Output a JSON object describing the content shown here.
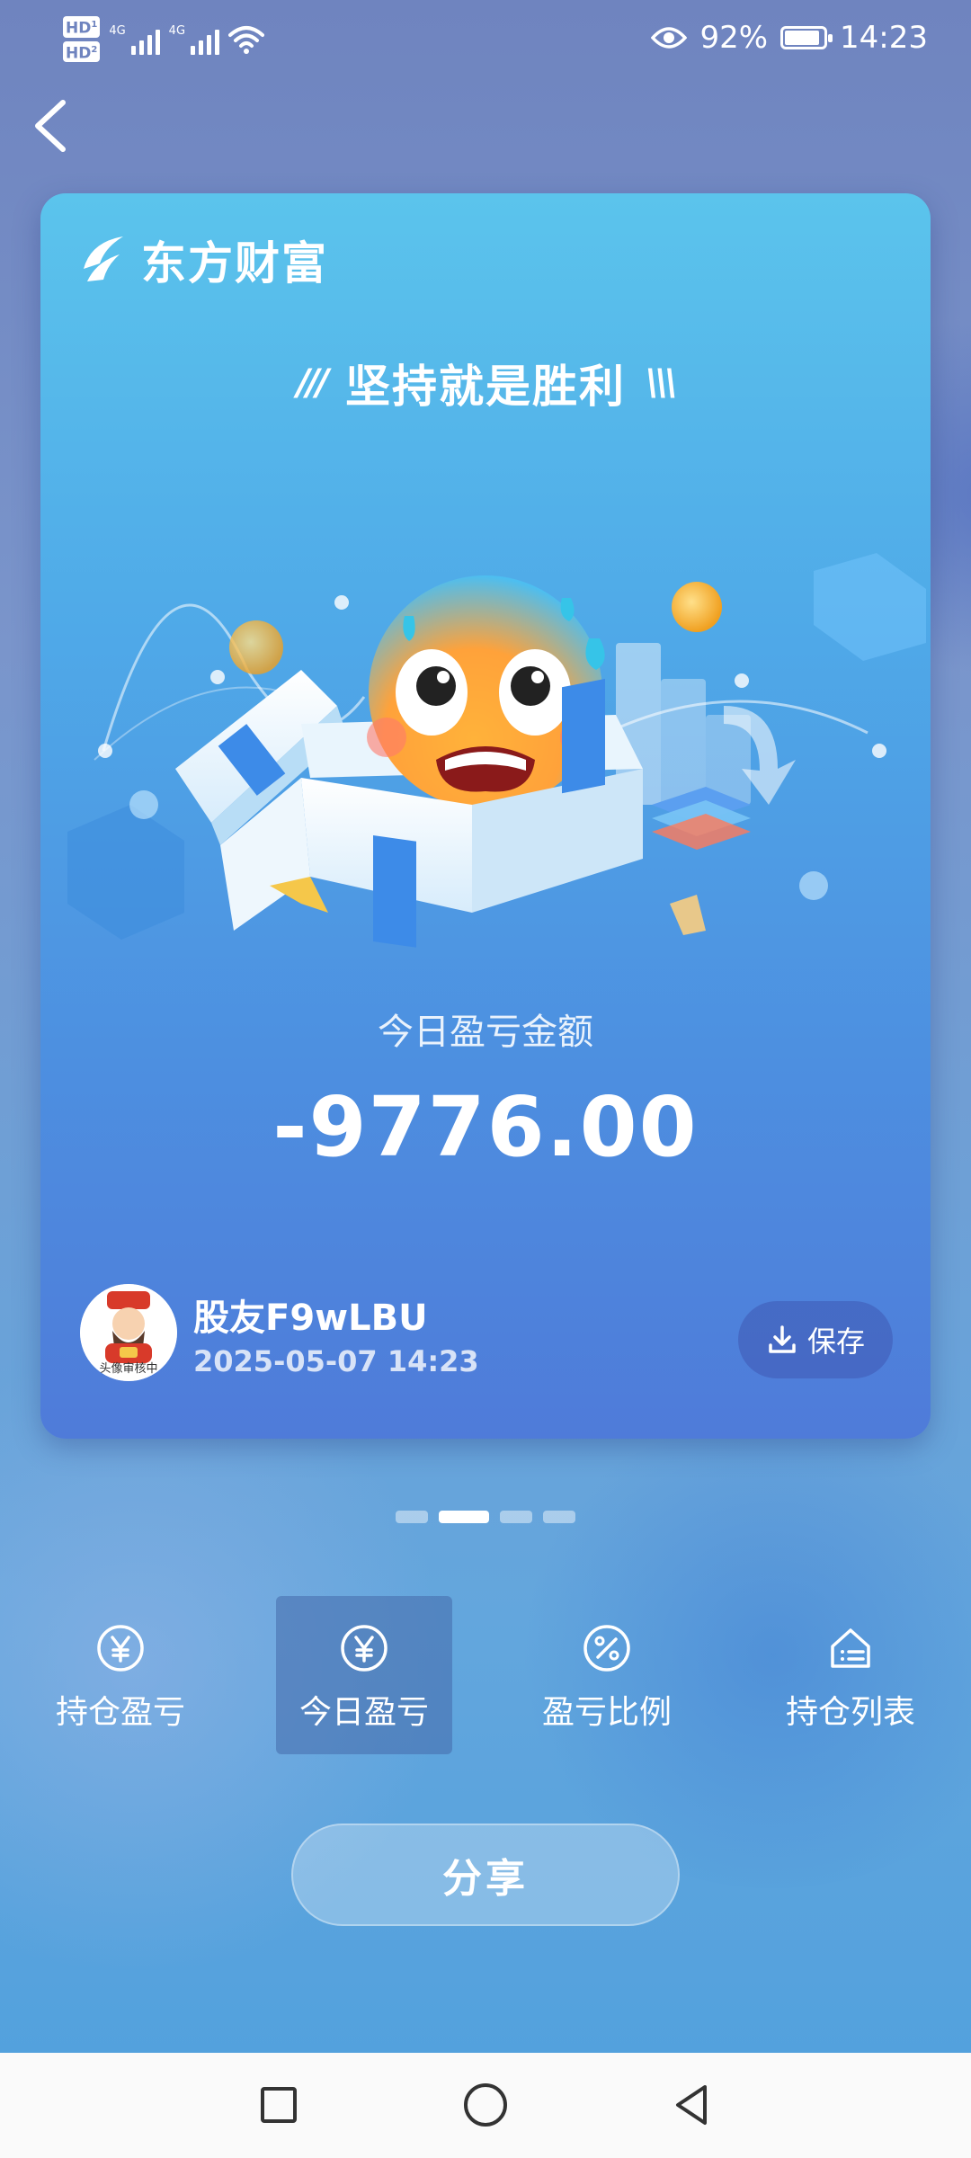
{
  "status_bar": {
    "sim1": "HD",
    "sim1_index": "1",
    "sim2": "HD",
    "sim2_index": "2",
    "network1": "4G",
    "network2": "4G",
    "battery_percent": "92%",
    "battery_level": 0.92,
    "time": "14:23"
  },
  "card": {
    "brand": "东方财富",
    "slogan": "坚持就是胜利",
    "metric_label": "今日盈亏金额",
    "amount": "-9776.00",
    "user_name": "股友F9wLBU",
    "timestamp": "2025-05-07 14:23",
    "save_label": "保存",
    "avatar_caption": "头像审核中"
  },
  "pager": {
    "count": 4,
    "active_index": 1
  },
  "tabs": [
    {
      "label": "持仓盈亏",
      "icon": "yen-circle-icon"
    },
    {
      "label": "今日盈亏",
      "icon": "yen-circle-icon",
      "selected": true
    },
    {
      "label": "盈亏比例",
      "icon": "percent-circle-icon"
    },
    {
      "label": "持仓列表",
      "icon": "house-list-icon"
    }
  ],
  "share_label": "分享",
  "colors": {
    "card_top": "#5bc4ec",
    "card_bottom": "#4f7bd9",
    "background": "#6f84bf",
    "text": "#ffffff"
  }
}
